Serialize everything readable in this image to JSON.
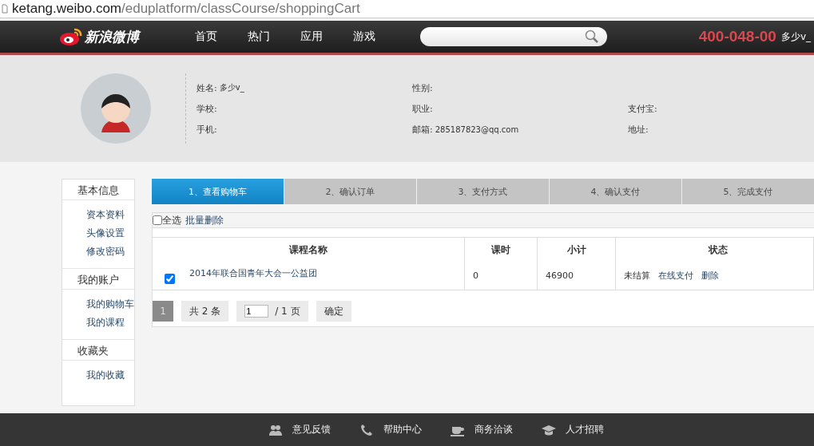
{
  "address_bar": {
    "host": "ketang.weibo.com",
    "path": "/eduplatform/classCourse/shoppingCart"
  },
  "header": {
    "logo": "新浪微博",
    "nav": [
      {
        "label": "首页"
      },
      {
        "label": "热门"
      },
      {
        "label": "应用"
      },
      {
        "label": "游戏"
      }
    ],
    "phone": "400-048-00",
    "user": "多少v_"
  },
  "profile": {
    "rows": [
      [
        {
          "label": "姓名:",
          "value": "多少v_"
        },
        {
          "label": "性别:"
        }
      ],
      [
        {
          "label": "学校:"
        },
        {
          "label": "职业:"
        },
        {
          "label": "支付宝:"
        }
      ],
      [
        {
          "label": "手机:"
        },
        {
          "label": "邮箱:",
          "value": "285187823@qq.com"
        },
        {
          "label": "地址:"
        }
      ]
    ]
  },
  "sidebar": {
    "sections": [
      {
        "title": "基本信息",
        "items": [
          {
            "label": "资本资料"
          },
          {
            "label": "头像设置"
          },
          {
            "label": "修改密码"
          }
        ]
      },
      {
        "title": "我的账户",
        "items": [
          {
            "label": "我的购物车"
          },
          {
            "label": "我的课程"
          }
        ]
      },
      {
        "title": "收藏夹",
        "items": [
          {
            "label": "我的收藏"
          }
        ]
      }
    ]
  },
  "steps": [
    {
      "label": "1、查看购物车",
      "selected": true
    },
    {
      "label": "2、确认订单",
      "selected": false
    },
    {
      "label": "3、支付方式",
      "selected": false
    },
    {
      "label": "4、确认支付",
      "selected": false
    },
    {
      "label": "5、完成支付",
      "selected": false
    }
  ],
  "toolbar": {
    "select_all": {
      "label": "全选",
      "checked": false
    },
    "batch_delete": "批量删除"
  },
  "table": {
    "columns": [
      "课程名称",
      "课时",
      "小计",
      "状态"
    ],
    "rows": [
      {
        "checked": true,
        "name": "2014年联合国青年大会一公益团",
        "hours": "0",
        "subtotal": "46900",
        "status": "未结算",
        "actions": [
          "在线支付",
          "删除"
        ]
      }
    ]
  },
  "pagination": {
    "current": "1",
    "total": "共 2 条",
    "page_input": "1",
    "pages": "/ 1 页",
    "confirm": "确定"
  },
  "footer": {
    "links": [
      {
        "kind": "people",
        "label": "意见反馈"
      },
      {
        "kind": "phone",
        "label": "帮助中心"
      },
      {
        "kind": "cup",
        "label": "商务洽谈"
      },
      {
        "kind": "cap",
        "label": "人才招聘"
      }
    ]
  }
}
